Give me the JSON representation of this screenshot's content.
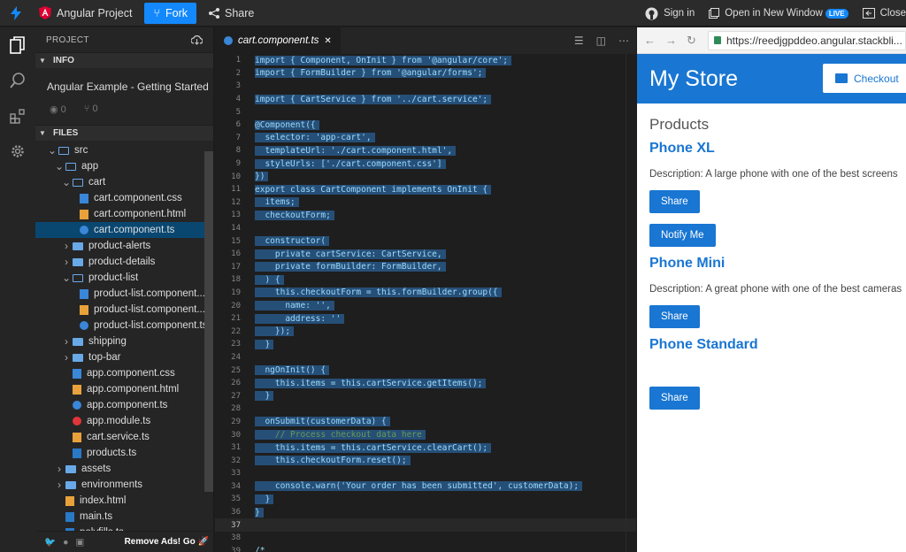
{
  "topbar": {
    "project_name": "Angular Project",
    "fork_label": "Fork",
    "share_label": "Share",
    "signin_label": "Sign in",
    "open_new_window_label": "Open in New Window",
    "live_badge": "LIVE",
    "close_label": "Close",
    "accent_color": "#1389fd"
  },
  "sidebar": {
    "header": "PROJECT",
    "info_section": "INFO",
    "info_title": "Angular Example - Getting Started",
    "views_count": "0",
    "forks_count": "0",
    "files_section": "FILES",
    "tree": [
      {
        "depth": 1,
        "twisty": "open",
        "icon": "folder-open",
        "label": "src"
      },
      {
        "depth": 2,
        "twisty": "open",
        "icon": "folder-open",
        "label": "app"
      },
      {
        "depth": 3,
        "twisty": "open",
        "icon": "folder-open",
        "label": "cart"
      },
      {
        "depth": 4,
        "twisty": "",
        "icon": "css",
        "label": "cart.component.css"
      },
      {
        "depth": 4,
        "twisty": "",
        "icon": "html",
        "label": "cart.component.html"
      },
      {
        "depth": 4,
        "twisty": "",
        "icon": "angular",
        "label": "cart.component.ts",
        "active": true
      },
      {
        "depth": 3,
        "twisty": "closed",
        "icon": "folder",
        "label": "product-alerts"
      },
      {
        "depth": 3,
        "twisty": "closed",
        "icon": "folder",
        "label": "product-details"
      },
      {
        "depth": 3,
        "twisty": "open",
        "icon": "folder-open",
        "label": "product-list"
      },
      {
        "depth": 4,
        "twisty": "",
        "icon": "css",
        "label": "product-list.component...."
      },
      {
        "depth": 4,
        "twisty": "",
        "icon": "html",
        "label": "product-list.component...."
      },
      {
        "depth": 4,
        "twisty": "",
        "icon": "angular",
        "label": "product-list.component.ts"
      },
      {
        "depth": 3,
        "twisty": "closed",
        "icon": "folder",
        "label": "shipping"
      },
      {
        "depth": 3,
        "twisty": "closed",
        "icon": "folder",
        "label": "top-bar"
      },
      {
        "depth": 3,
        "twisty": "",
        "icon": "css",
        "label": "app.component.css"
      },
      {
        "depth": 3,
        "twisty": "",
        "icon": "html",
        "label": "app.component.html"
      },
      {
        "depth": 3,
        "twisty": "",
        "icon": "angular",
        "label": "app.component.ts"
      },
      {
        "depth": 3,
        "twisty": "",
        "icon": "angular red",
        "label": "app.module.ts"
      },
      {
        "depth": 3,
        "twisty": "",
        "icon": "html",
        "label": "cart.service.ts"
      },
      {
        "depth": 3,
        "twisty": "",
        "icon": "tsblue",
        "label": "products.ts"
      },
      {
        "depth": 2,
        "twisty": "closed",
        "icon": "folder",
        "label": "assets"
      },
      {
        "depth": 2,
        "twisty": "closed",
        "icon": "folder",
        "label": "environments"
      },
      {
        "depth": 2,
        "twisty": "",
        "icon": "html",
        "label": "index.html"
      },
      {
        "depth": 2,
        "twisty": "",
        "icon": "tsblue",
        "label": "main.ts"
      },
      {
        "depth": 2,
        "twisty": "",
        "icon": "tsblue",
        "label": "polyfills.ts"
      }
    ],
    "footer_ad": "Remove Ads! Go"
  },
  "editor": {
    "tab_label": "cart.component.ts",
    "current_line": 37,
    "lines": [
      "import { Component, OnInit } from '@angular/core';",
      "import { FormBuilder } from '@angular/forms';",
      "",
      "import { CartService } from '../cart.service';",
      "",
      "@Component({",
      "  selector: 'app-cart',",
      "  templateUrl: './cart.component.html',",
      "  styleUrls: ['./cart.component.css']",
      "})",
      "export class CartComponent implements OnInit {",
      "  items;",
      "  checkoutForm;",
      "",
      "  constructor(",
      "    private cartService: CartService,",
      "    private formBuilder: FormBuilder,",
      "  ) {",
      "    this.checkoutForm = this.formBuilder.group({",
      "      name: '',",
      "      address: ''",
      "    });",
      "  }",
      "",
      "  ngOnInit() {",
      "    this.items = this.cartService.getItems();",
      "  }",
      "",
      "  onSubmit(customerData) {",
      "    // Process checkout data here",
      "    this.items = this.cartService.clearCart();",
      "    this.checkoutForm.reset();",
      "",
      "    console.warn('Your order has been submitted', customerData);",
      "  }",
      "}",
      "",
      "",
      "/*"
    ]
  },
  "preview": {
    "url": "https://reedjgpddeo.angular.stackbli...",
    "store_title": "My Store",
    "checkout_label": "Checkout",
    "products_heading": "Products",
    "products": [
      {
        "name": "Phone XL",
        "description": "Description: A large phone with one of the best screens",
        "buttons": [
          "Share",
          "Notify Me"
        ]
      },
      {
        "name": "Phone Mini",
        "description": "Description: A great phone with one of the best cameras",
        "buttons": [
          "Share"
        ]
      },
      {
        "name": "Phone Standard",
        "description": "",
        "buttons": [
          "Share"
        ]
      }
    ],
    "brand_color": "#1976d2"
  }
}
